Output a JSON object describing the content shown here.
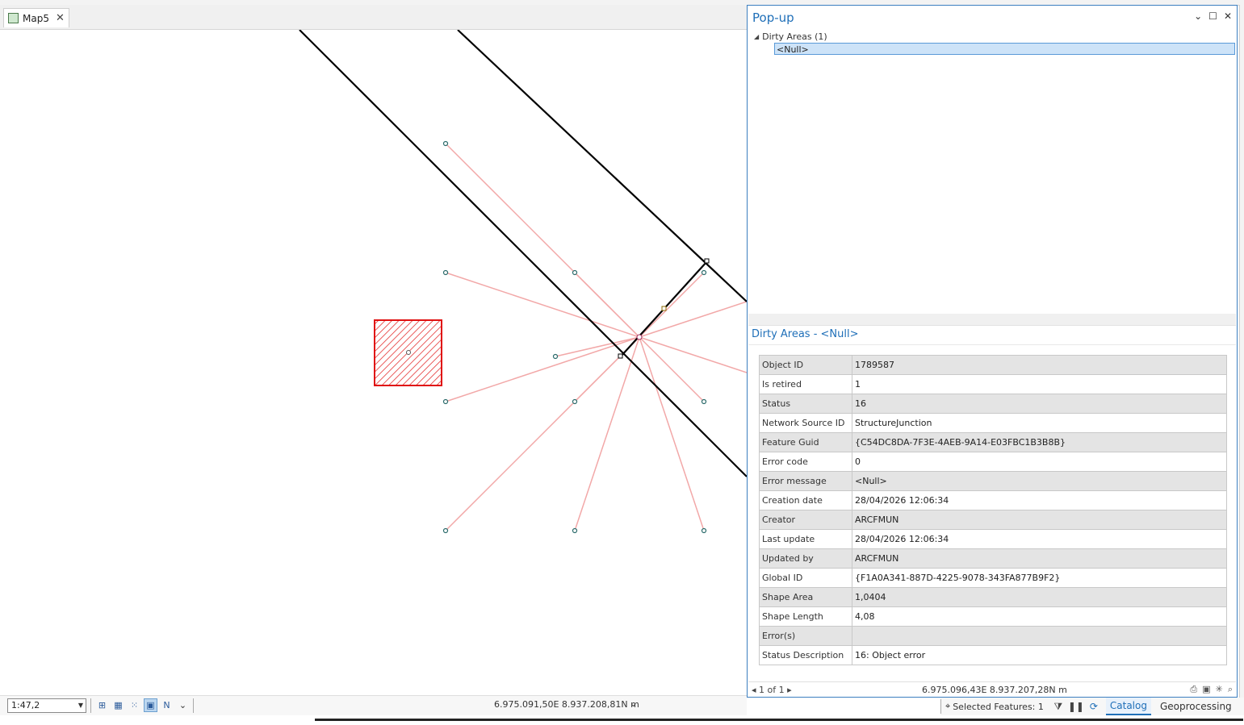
{
  "map": {
    "tab_label": "Map5",
    "scale": "1:47,2",
    "coordinates": "6.975.091,50E 8.937.208,81N m"
  },
  "popup": {
    "title": "Pop-up",
    "tree_root": "Dirty Areas (1)",
    "tree_child": "<Null>",
    "detail_title": "Dirty Areas - <Null>",
    "attributes": [
      {
        "key": "Object ID",
        "value": "1789587"
      },
      {
        "key": "Is retired",
        "value": "1"
      },
      {
        "key": "Status",
        "value": "16"
      },
      {
        "key": "Network Source ID",
        "value": "StructureJunction"
      },
      {
        "key": "Feature Guid",
        "value": "{C54DC8DA-7F3E-4AEB-9A14-E03FBC1B3B8B}"
      },
      {
        "key": "Error code",
        "value": "0"
      },
      {
        "key": "Error message",
        "value": "<Null>"
      },
      {
        "key": "Creation date",
        "value": "28/04/2026 12:06:34"
      },
      {
        "key": "Creator",
        "value": "ARCFMUN"
      },
      {
        "key": "Last update",
        "value": "28/04/2026 12:06:34"
      },
      {
        "key": "Updated by",
        "value": "ARCFMUN"
      },
      {
        "key": "Global ID",
        "value": "{F1A0A341-887D-4225-9078-343FA877B9F2}"
      },
      {
        "key": "Shape Area",
        "value": "1,0404"
      },
      {
        "key": "Shape Length",
        "value": "4,08"
      },
      {
        "key": "Error(s)",
        "value": ""
      },
      {
        "key": "Status Description",
        "value": "16: Object error"
      }
    ],
    "pager": "1 of 1",
    "footer_coordinates": "6.975.096,43E 8.937.207,28N m"
  },
  "status": {
    "selected_features": "Selected Features: 1",
    "tab_catalog": "Catalog",
    "tab_geoprocessing": "Geoprocessing"
  },
  "colors": {
    "accent": "#1f6fb8",
    "dirty_area": "#e01010",
    "connector_line": "#f2a8a8",
    "line": "#000000"
  }
}
